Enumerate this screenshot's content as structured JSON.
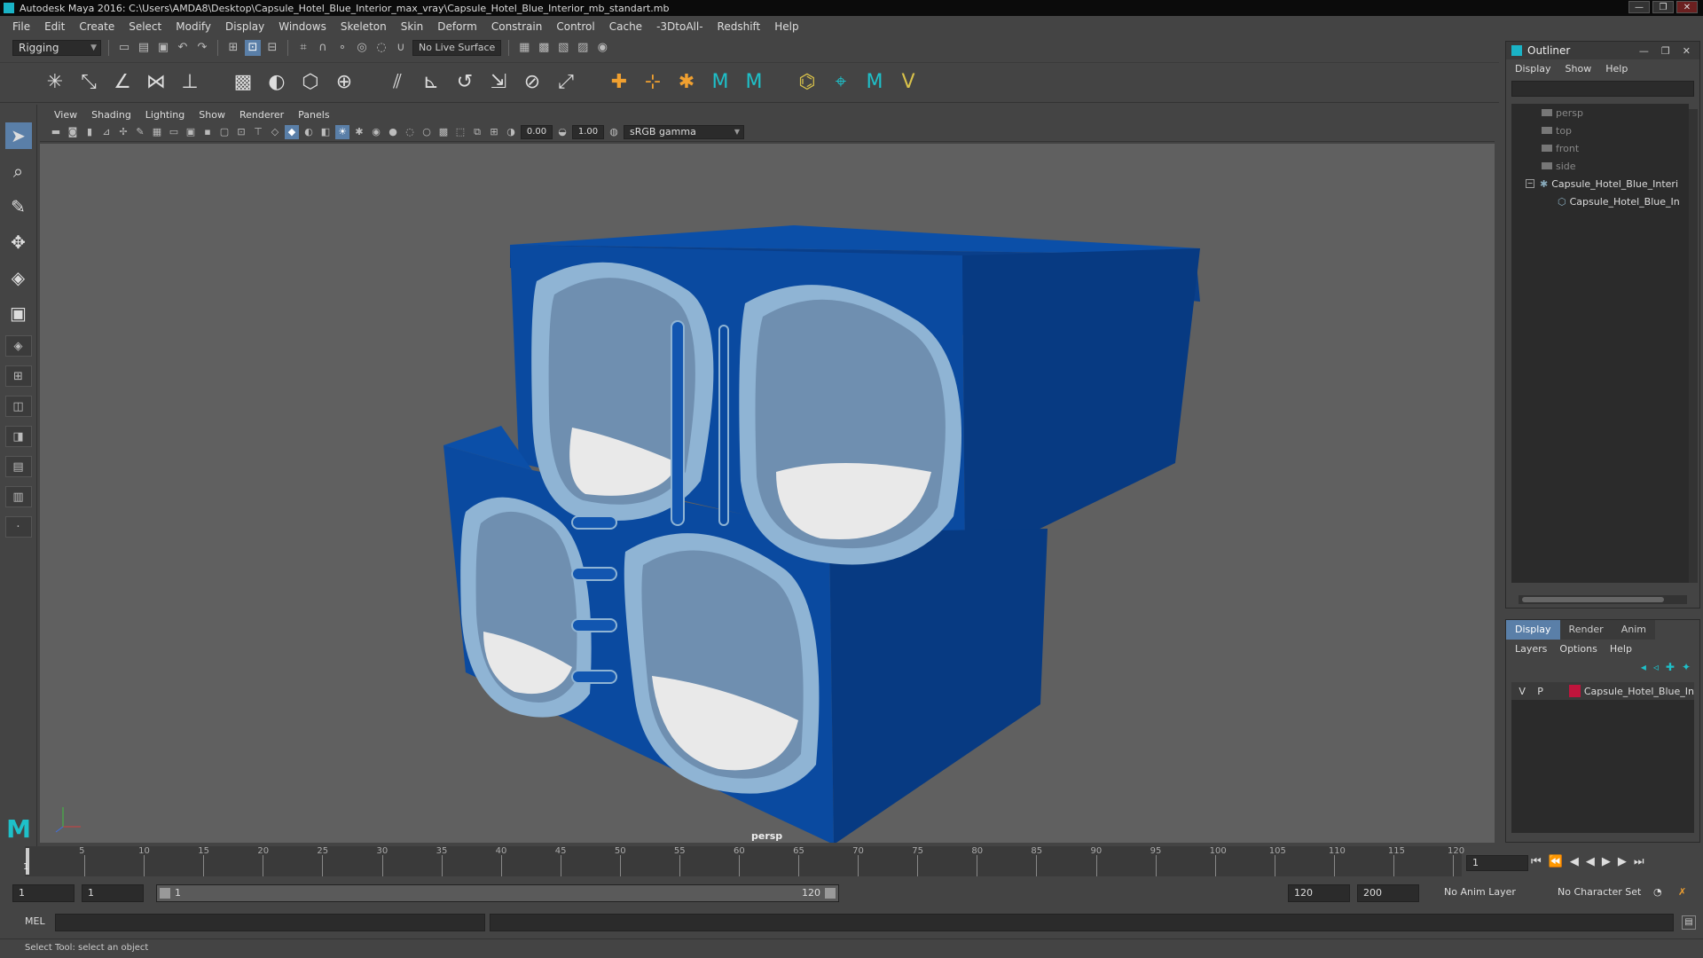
{
  "window": {
    "title": "Autodesk Maya 2016: C:\\Users\\AMDA8\\Desktop\\Capsule_Hotel_Blue_Interior_max_vray\\Capsule_Hotel_Blue_Interior_mb_standart.mb",
    "controls": [
      "—",
      "❐",
      "✕"
    ]
  },
  "menubar": [
    "File",
    "Edit",
    "Create",
    "Select",
    "Modify",
    "Display",
    "Windows",
    "Skeleton",
    "Skin",
    "Deform",
    "Constrain",
    "Control",
    "Cache",
    "-3DtoAll-",
    "Redshift",
    "Help"
  ],
  "status_line": {
    "menu_set": "Rigging",
    "live_surface": "No Live Surface"
  },
  "panel": {
    "menus": [
      "View",
      "Shading",
      "Lighting",
      "Show",
      "Renderer",
      "Panels"
    ],
    "exposure": "0.00",
    "gamma": "1.00",
    "color_space": "sRGB gamma",
    "camera_label": "persp"
  },
  "outliner": {
    "title": "Outliner",
    "menus": [
      "Display",
      "Show",
      "Help"
    ],
    "cameras": [
      "persp",
      "top",
      "front",
      "side"
    ],
    "group": "Capsule_Hotel_Blue_Interi",
    "child": "Capsule_Hotel_Blue_In"
  },
  "layer_editor": {
    "tabs": [
      "Display",
      "Render",
      "Anim"
    ],
    "menus": [
      "Layers",
      "Options",
      "Help"
    ],
    "layer": {
      "v": "V",
      "p": "P",
      "name": "Capsule_Hotel_Blue_In",
      "color": "#c0143c"
    }
  },
  "timeline": {
    "ticks": [
      "5",
      "10",
      "15",
      "20",
      "25",
      "30",
      "35",
      "40",
      "45",
      "50",
      "55",
      "60",
      "65",
      "70",
      "75",
      "80",
      "85",
      "90",
      "95",
      "100",
      "105",
      "110",
      "115",
      "120"
    ],
    "current_frame": "1",
    "current_field": "1"
  },
  "range": {
    "start": "1",
    "playback_start": "1",
    "slider_start": "1",
    "slider_end": "120",
    "playback_end": "120",
    "end": "200",
    "anim_layer": "No Anim Layer",
    "character_set": "No Character Set"
  },
  "command_line": {
    "label": "MEL"
  },
  "help_line": "Select Tool: select an object",
  "colors": {
    "capsule_blue": "#0a4aa0",
    "capsule_trim": "#8fb4d4",
    "viewport_bg": "#606060",
    "accent": "#5a7fa8"
  }
}
